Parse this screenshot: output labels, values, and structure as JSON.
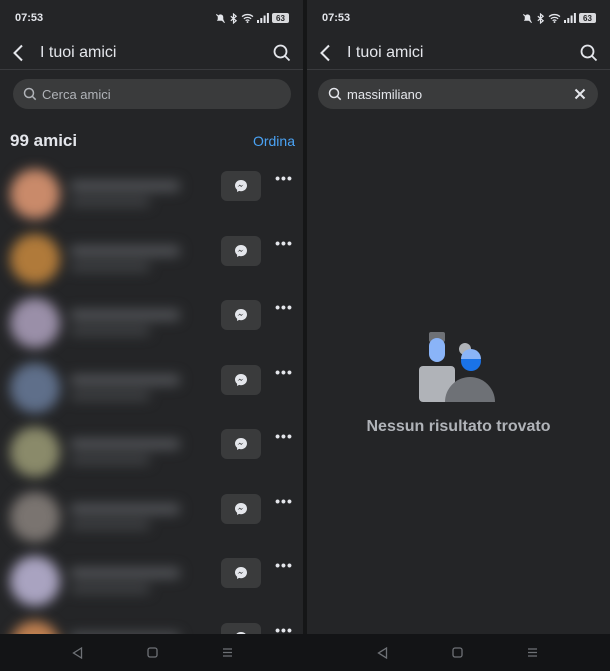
{
  "left": {
    "status": {
      "time": "07:53",
      "battery": "63"
    },
    "appbar": {
      "title": "I tuoi amici"
    },
    "search": {
      "placeholder": "Cerca amici",
      "value": ""
    },
    "friends": {
      "count_label": "99 amici",
      "sort_label": "Ordina"
    },
    "friend_rows": [
      {
        "avatar_color": "#c98a6a"
      },
      {
        "avatar_color": "#b07a3a"
      },
      {
        "avatar_color": "#9a8fa8"
      },
      {
        "avatar_color": "#5f6f8a"
      },
      {
        "avatar_color": "#8a8a6a"
      },
      {
        "avatar_color": "#7a7470"
      },
      {
        "avatar_color": "#a9a3c0"
      },
      {
        "avatar_color": "#c08050"
      }
    ],
    "more_label": "•••"
  },
  "right": {
    "status": {
      "time": "07:53",
      "battery": "63"
    },
    "appbar": {
      "title": "I tuoi amici"
    },
    "search": {
      "value": "massimiliano"
    },
    "empty_message": "Nessun risultato trovato"
  },
  "colors": {
    "accent": "#4aa3f5",
    "empty_primary": "#8ab4f8",
    "empty_accent": "#1a73e8"
  },
  "icons": [
    "back-arrow-icon",
    "search-icon",
    "messenger-icon",
    "more-icon",
    "clear-icon",
    "no-results-people-icon",
    "nav-back-icon",
    "nav-home-icon",
    "nav-recents-icon"
  ]
}
